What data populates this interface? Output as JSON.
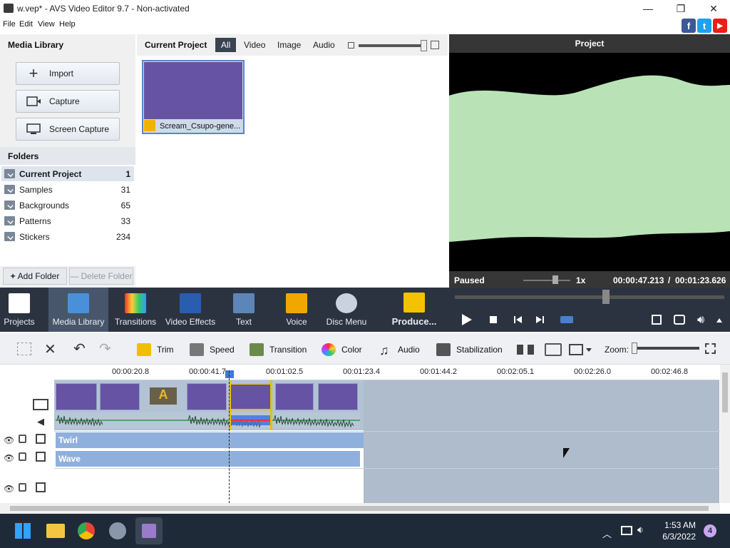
{
  "window": {
    "title": "w.vep* - AVS Video Editor 9.7 - Non-activated"
  },
  "menu": [
    "File",
    "Edit",
    "View",
    "Help"
  ],
  "social": {
    "fb": "f",
    "tw": "t",
    "yt": "▶"
  },
  "library": {
    "title": "Media Library",
    "buttons": [
      {
        "label": "Import"
      },
      {
        "label": "Capture"
      },
      {
        "label": "Screen Capture"
      }
    ],
    "folders_title": "Folders",
    "folders": [
      {
        "name": "Current Project",
        "count": "1"
      },
      {
        "name": "Samples",
        "count": "31"
      },
      {
        "name": "Backgrounds",
        "count": "65"
      },
      {
        "name": "Patterns",
        "count": "33"
      },
      {
        "name": "Stickers",
        "count": "234"
      }
    ],
    "add_folder": "Add Folder",
    "delete_folder": "Delete Folder"
  },
  "media": {
    "title": "Current Project",
    "tabs": [
      "All",
      "Video",
      "Image",
      "Audio"
    ],
    "thumb_label": "Scream_Csupo-gene..."
  },
  "preview": {
    "title": "Project",
    "status": "Paused",
    "speed": "1x",
    "time_current": "00:00:47.213",
    "time_sep": "/",
    "time_total": "00:01:23.626",
    "seek_fraction": 0.56
  },
  "tools": [
    {
      "label": "Projects"
    },
    {
      "label": "Media Library"
    },
    {
      "label": "Transitions"
    },
    {
      "label": "Video Effects"
    },
    {
      "label": "Text"
    },
    {
      "label": "Voice"
    },
    {
      "label": "Disc Menu"
    },
    {
      "label": "Produce..."
    }
  ],
  "timeline_tools": [
    "Trim",
    "Speed",
    "Transition",
    "Color",
    "Audio",
    "Stabilization"
  ],
  "zoom_label": "Zoom:",
  "ruler": [
    "00:00:20.8",
    "00:00:41.7",
    "00:01:02.5",
    "00:01:23.4",
    "00:01:44.2",
    "00:02:05.1",
    "00:02:26.0",
    "00:02:46.8"
  ],
  "effects": [
    {
      "name": "Twirl"
    },
    {
      "name": "Wave"
    }
  ],
  "taskbar": {
    "time": "1:53 AM",
    "date": "6/3/2022",
    "badge": "4"
  },
  "colors": {
    "accent": "#3a4352",
    "toolbar": "#2c3340",
    "fx": "#8fb0dc",
    "clip": "#6653a3"
  }
}
